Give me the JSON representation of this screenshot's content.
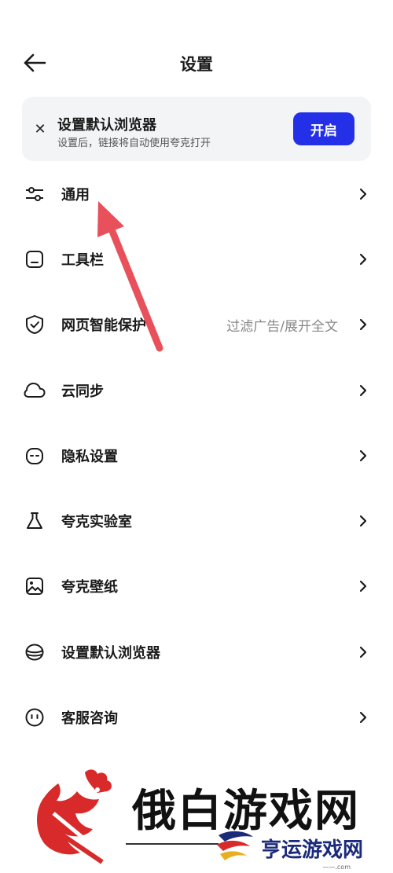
{
  "header": {
    "title": "设置",
    "back_icon": "arrow-left-icon"
  },
  "banner": {
    "title": "设置默认浏览器",
    "subtitle": "设置后，链接将自动使用夸克打开",
    "button_label": "开启",
    "close_icon": "close-icon",
    "accent_color": "#2430e8"
  },
  "menu": {
    "items": [
      {
        "label": "通用",
        "icon": "sliders-icon",
        "value": ""
      },
      {
        "label": "工具栏",
        "icon": "toolbar-icon",
        "value": ""
      },
      {
        "label": "网页智能保护",
        "icon": "shield-check-icon",
        "value": "过滤广告/展开全文"
      },
      {
        "label": "云同步",
        "icon": "cloud-icon",
        "value": ""
      },
      {
        "label": "隐私设置",
        "icon": "privacy-mask-icon",
        "value": ""
      },
      {
        "label": "夸克实验室",
        "icon": "flask-icon",
        "value": ""
      },
      {
        "label": "夸克壁纸",
        "icon": "image-icon",
        "value": ""
      },
      {
        "label": "设置默认浏览器",
        "icon": "browser-default-icon",
        "value": ""
      },
      {
        "label": "客服咨询",
        "icon": "smile-service-icon",
        "value": ""
      }
    ]
  },
  "annotation": {
    "arrow_color": "#e8505b"
  },
  "watermark": {
    "main_text": "俄白游戏网",
    "sub_text": "亨运游戏网",
    "url_text": "——.com"
  }
}
